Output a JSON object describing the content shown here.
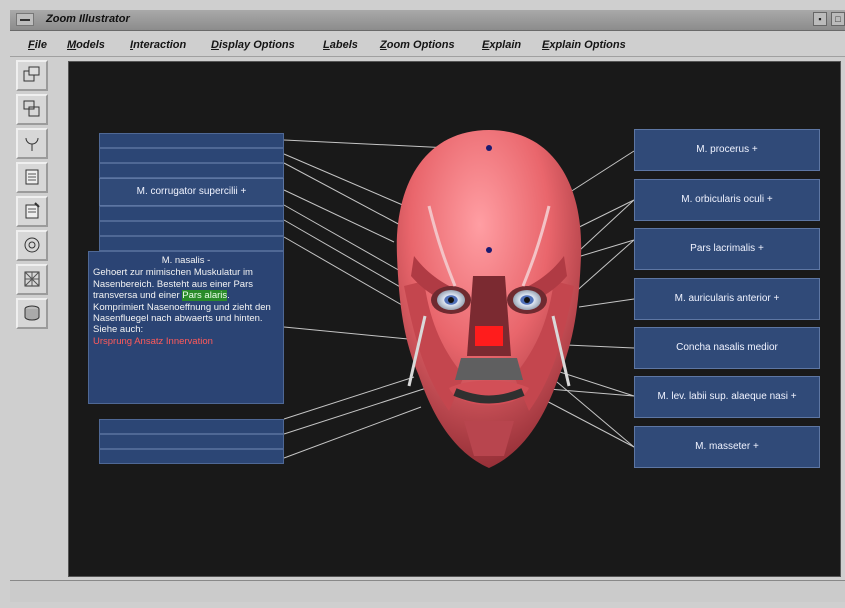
{
  "window": {
    "title": "Zoom Illustrator"
  },
  "menu": [
    "File",
    "Models",
    "Interaction",
    "Display Options",
    "Labels",
    "Zoom Options",
    "Explain",
    "Explain Options"
  ],
  "toolbar_icons": [
    "window-icon",
    "copy-windows-icon",
    "rotate-icon",
    "document-icon",
    "edit-document-icon",
    "target-icon",
    "grid-zoom-icon",
    "database-icon"
  ],
  "left_labels": {
    "corrugator": "M. corrugator supercilii +",
    "panel_title": "M. nasalis -",
    "panel_text": "Gehoert zur mimischen Muskulatur im Nasenbereich. Besteht aus einer Pars transversa und einer ",
    "panel_green": "Pars alaris",
    "panel_after": ". Komprimiert Nasenoeffnung und zieht den Nasenfluegel nach abwaerts und hinten. Siehe auch:",
    "links": [
      "Ursprung",
      "Ansatz",
      "Innervation"
    ]
  },
  "right_labels": [
    "M. procerus +",
    "M. orbicularis oculi +",
    "Pars lacrimalis +",
    "M. auricularis anterior +",
    "Concha nasalis medior",
    "M. lev. labii sup. alaeque nasi +",
    "M. masseter +"
  ],
  "colors": {
    "viewport_bg": "#191919",
    "label_bg": "#304a78",
    "muscle_red": "#e9666c"
  }
}
